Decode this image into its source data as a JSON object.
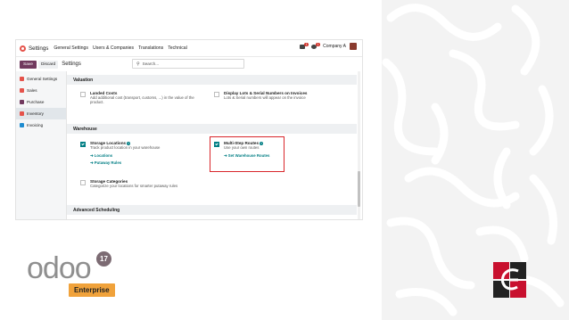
{
  "topbar": {
    "app_title": "Settings",
    "menu": [
      "General Settings",
      "Users & Companies",
      "Translations",
      "Technical"
    ],
    "company": "Company A",
    "activity_badge": "1",
    "messages_badge": "1"
  },
  "control": {
    "save_label": "Save",
    "discard_label": "Discard",
    "breadcrumb": "Settings",
    "search_placeholder": "Search..."
  },
  "sidebar": {
    "items": [
      {
        "label": "General Settings",
        "color": "#e5534b"
      },
      {
        "label": "Sales",
        "color": "#e5534b"
      },
      {
        "label": "Purchase",
        "color": "#71395e"
      },
      {
        "label": "Inventory",
        "color": "#e5534b",
        "active": true
      },
      {
        "label": "Invoicing",
        "color": "#1f8cd0"
      }
    ]
  },
  "sections": {
    "valuation": "Valuation",
    "warehouse": "Warehouse",
    "advanced": "Advanced Scheduling"
  },
  "settings": {
    "landed_costs": {
      "title": "Landed Costs",
      "desc": "Add additional cost (transport, customs, ...) in the value of the product.",
      "checked": false
    },
    "lots": {
      "title": "Display Lots & Serial Numbers on Invoices",
      "desc": "Lots & Serial numbers will appear on the invoice",
      "checked": false
    },
    "storage_locations": {
      "title": "Storage Locations",
      "desc": "Track product location in your warehouse",
      "checked": true,
      "link1": "Locations",
      "link2": "Putaway Rules"
    },
    "multi_step": {
      "title": "Multi-Step Routes",
      "desc": "Use your own routes",
      "checked": true,
      "link": "Set Warehouse Routes"
    },
    "storage_categories": {
      "title": "Storage Categories",
      "desc": "Categorize your locations for smarter putaway rules",
      "checked": false
    }
  },
  "branding": {
    "odoo": "odoo",
    "version": "17",
    "edition": "Enterprise"
  },
  "colors": {
    "primary": "#71395e",
    "teal": "#017e84",
    "highlight": "#d9262b",
    "enterprise": "#f0a23b"
  }
}
